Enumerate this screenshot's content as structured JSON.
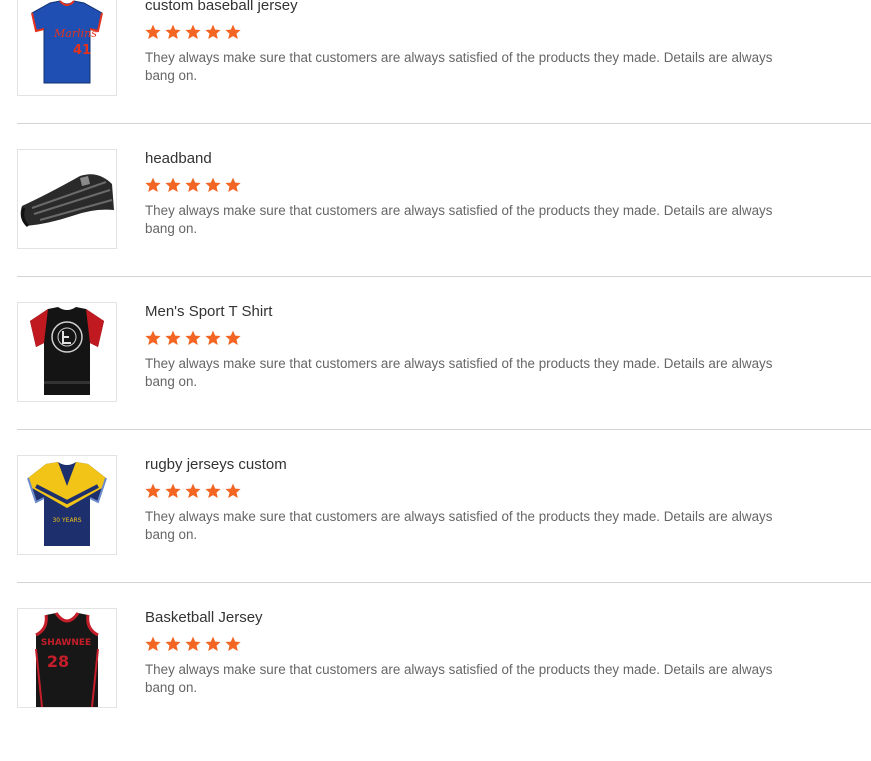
{
  "colors": {
    "star": "#f26522",
    "divider": "#d4d4d4",
    "text": "#666666"
  },
  "reviews": [
    {
      "product": "custom baseball jersey",
      "rating": 5,
      "text": "They always make sure that customers are always satisfied of the products they made. Details are always bang on.",
      "image_icon": "baseball-jersey-image"
    },
    {
      "product": "headband",
      "rating": 5,
      "text": "They always make sure that customers are always satisfied of the products they made. Details are always bang on.",
      "image_icon": "headband-image"
    },
    {
      "product": "Men's Sport T Shirt",
      "rating": 5,
      "text": "They always make sure that customers are always satisfied of the products they made. Details are always bang on.",
      "image_icon": "sport-t-shirt-image"
    },
    {
      "product": "rugby jerseys custom",
      "rating": 5,
      "text": "They always make sure that customers are always satisfied of the products they made. Details are always bang on.",
      "image_icon": "rugby-jersey-image"
    },
    {
      "product": "Basketball Jersey",
      "rating": 5,
      "text": "They always make sure that customers are always satisfied of the products they made. Details are always bang on.",
      "image_icon": "basketball-jersey-image"
    }
  ],
  "thumb_labels": {
    "baseball_script": "Marlins",
    "baseball_number": "41",
    "rugby_years": "30 YEARS",
    "basketball_script": "SHAWNEE",
    "basketball_number": "28"
  }
}
